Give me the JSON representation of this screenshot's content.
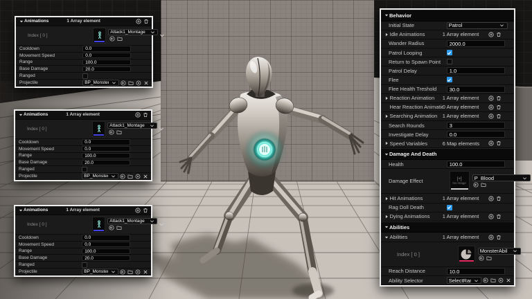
{
  "colors": {
    "check_blue": "#2b98ec",
    "montage_underline": "#4343e6",
    "ability_underline": "#e82e64",
    "no_image_underline": "#d6d6d6",
    "panel_border": "#ececec",
    "chest_orb_glow": "#7fe8dc"
  },
  "icons": {
    "add-element": "circle-plus",
    "delete": "trash-can",
    "expander-expanded": "caret-down",
    "expander-collapsed": "caret-right",
    "dropdown": "chevron-down",
    "use-selected-asset": "circle-arrow-left",
    "browse-to-asset": "folder",
    "pick-asset": "circle-dot",
    "clear-asset": "x",
    "checked": "checkmark"
  },
  "left_panels": [
    {
      "title": "Animations",
      "count": "1 Array element",
      "index": {
        "label": "Index [ 0 ]",
        "asset": "Attack1_Montage",
        "thumb": "animation-figure"
      },
      "fields": [
        {
          "label": "Cooldown",
          "type": "input",
          "value": "0.0"
        },
        {
          "label": "Movement Speed",
          "type": "input",
          "value": "0.0"
        },
        {
          "label": "Range",
          "type": "input",
          "value": "100.0"
        },
        {
          "label": "Base Damage",
          "type": "input",
          "value": "20.0"
        },
        {
          "label": "Ranged",
          "type": "checkbox",
          "checked": false
        },
        {
          "label": "Projectile",
          "type": "asset",
          "value": "BP_MonsterProjectile"
        }
      ]
    },
    {
      "title": "Animations",
      "count": "1 Array element",
      "index": {
        "label": "Index [ 0 ]",
        "asset": "Attack1_Montage",
        "thumb": "animation-figure"
      },
      "fields": [
        {
          "label": "Cooldown",
          "type": "input",
          "value": "0.0"
        },
        {
          "label": "Movement Speed",
          "type": "input",
          "value": "0.0"
        },
        {
          "label": "Range",
          "type": "input",
          "value": "100.0"
        },
        {
          "label": "Base Damage",
          "type": "input",
          "value": "20.0"
        },
        {
          "label": "Ranged",
          "type": "checkbox",
          "checked": false
        },
        {
          "label": "Projectile",
          "type": "asset",
          "value": "BP_MonsterProjectile"
        }
      ]
    },
    {
      "title": "Animations",
      "count": "1 Array element",
      "index": {
        "label": "Index [ 0 ]",
        "asset": "Attack1_Montage",
        "thumb": "animation-figure"
      },
      "fields": [
        {
          "label": "Cooldown",
          "type": "input",
          "value": "0.0"
        },
        {
          "label": "Movement Speed",
          "type": "input",
          "value": "0.0"
        },
        {
          "label": "Range",
          "type": "input",
          "value": "100.0"
        },
        {
          "label": "Base Damage",
          "type": "input",
          "value": "20.0"
        },
        {
          "label": "Ranged",
          "type": "checkbox",
          "checked": false
        },
        {
          "label": "Projectile",
          "type": "asset",
          "value": "BP_MonsterProjectile"
        }
      ]
    }
  ],
  "right_panel": {
    "rows": [
      {
        "kind": "section",
        "label": "Behavior"
      },
      {
        "kind": "dropdown",
        "label": "Initial State",
        "value": "Patrol"
      },
      {
        "kind": "array",
        "label": "Idle Animations",
        "value": "1 Array element",
        "expander": true
      },
      {
        "kind": "input",
        "label": "Wander Radius",
        "value": "2000.0"
      },
      {
        "kind": "check",
        "label": "Patrol Looping",
        "checked": true
      },
      {
        "kind": "check",
        "label": "Return to Spawn Point",
        "checked": false
      },
      {
        "kind": "input",
        "label": "Patrol Delay",
        "value": "1.0"
      },
      {
        "kind": "check",
        "label": "Flee",
        "checked": true
      },
      {
        "kind": "input",
        "label": "Flee Health Treshold",
        "value": "30.0"
      },
      {
        "kind": "array",
        "label": "Reaction Animation",
        "value": "1 Array element",
        "expander": true
      },
      {
        "kind": "array",
        "label": "Hear Reaction Animation",
        "value": "0 Array element",
        "expander": false
      },
      {
        "kind": "array",
        "label": "Searching Animation",
        "value": "1 Array element",
        "expander": true
      },
      {
        "kind": "input",
        "label": "Search Rounds",
        "value": "3"
      },
      {
        "kind": "input",
        "label": "Investigate Delay",
        "value": "0.0"
      },
      {
        "kind": "array",
        "label": "Speed Variables",
        "value": "6 Map elements",
        "expander": true
      },
      {
        "kind": "section",
        "label": "Damage And Death"
      },
      {
        "kind": "input",
        "label": "Health",
        "value": "100.0"
      },
      {
        "kind": "asset_big",
        "label": "Damage Effect",
        "value": "P_Blood",
        "thumb_text1": "[+]",
        "thumb_text2": "No Image"
      },
      {
        "kind": "array",
        "label": "Hit Animations",
        "value": "1 Array element",
        "expander": true
      },
      {
        "kind": "check",
        "label": "Rag Doll Death",
        "checked": true
      },
      {
        "kind": "array",
        "label": "Dying Animations",
        "value": "1 Array element",
        "expander": true
      },
      {
        "kind": "section",
        "label": "Abilities"
      },
      {
        "kind": "array_open",
        "label": "Abilities",
        "value": "1 Array element",
        "expander": true
      },
      {
        "kind": "index_big",
        "label": "Index [ 0 ]",
        "value": "MonsterAbil",
        "thumb": "ability-pie"
      },
      {
        "kind": "input",
        "label": "Reach Distance",
        "value": "10.0"
      },
      {
        "kind": "asset_small",
        "label": "Ability Selector",
        "value": "SelectRan"
      }
    ]
  }
}
